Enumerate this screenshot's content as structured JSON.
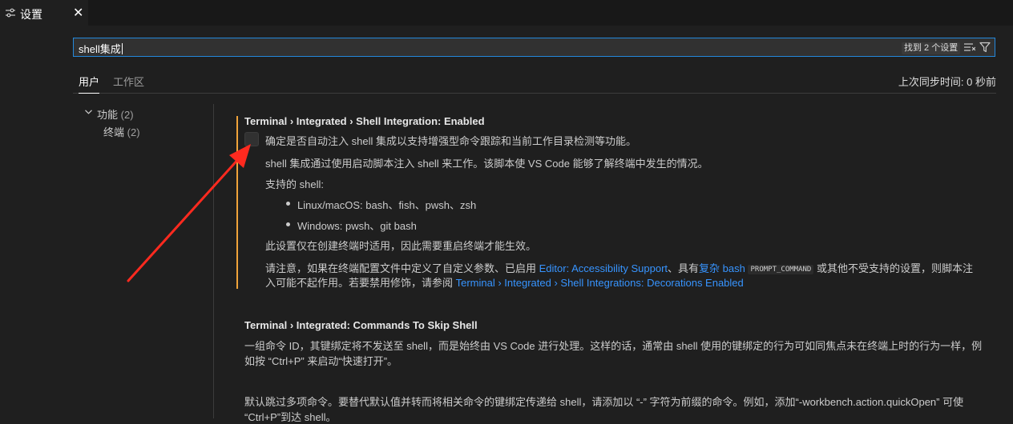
{
  "tab": {
    "title": "设置",
    "close": "✕"
  },
  "search": {
    "value": "shell集成",
    "result_count": "找到 2 个设置"
  },
  "scope_tabs": [
    {
      "label": "用户"
    },
    {
      "label": "工作区"
    }
  ],
  "sync_status": "上次同步时间: 0 秒前",
  "toc": [
    {
      "label": "功能",
      "count": "(2)"
    },
    {
      "label": "终端",
      "count": "(2)"
    }
  ],
  "settings": [
    {
      "title": "Terminal › Integrated › Shell Integration: Enabled",
      "checkbox_label": "确定是否自动注入 shell 集成以支持增强型命令跟踪和当前工作目录检测等功能。",
      "p1": "shell 集成通过使用启动脚本注入 shell 来工作。该脚本使 VS Code 能够了解终端中发生的情况。",
      "supported_label": "支持的 shell:",
      "list": [
        "Linux/macOS: bash、fish、pwsh、zsh",
        "Windows: pwsh、git bash"
      ],
      "p2": "此设置仅在创建终端时适用，因此需要重启终端才能生效。",
      "note": {
        "pre": "请注意，如果在终端配置文件中定义了自定义参数、已启用 ",
        "link1": "Editor: Accessibility Support",
        "mid1": "、具有",
        "link2": "复杂 bash",
        "code": "PROMPT_COMMAND",
        "mid2": " 或其他不受支持的设置，则脚本注",
        "line2_pre": "入可能不起作用。若要禁用修饰，请参阅 ",
        "link3": "Terminal › Integrated › Shell Integrations: Decorations Enabled"
      }
    },
    {
      "title": "Terminal › Integrated: Commands To Skip Shell",
      "desc_line1": "一组命令 ID，其键绑定将不发送至 shell，而是始终由 VS Code 进行处理。这样的话，通常由 shell 使用的键绑定的行为可如同焦点未在终端上时的行为一样，例",
      "desc_line2": "如按 “Ctrl+P” 来启动“快速打开”。",
      "desc2_line1": "默认跳过多项命令。要替代默认值并转而将相关命令的键绑定传递给 shell，请添加以 “-” 字符为前缀的命令。例如，添加“-workbench.action.quickOpen” 可使",
      "desc2_line2": "“Ctrl+P”到达 shell。"
    }
  ],
  "colors": {
    "modified_indicator": "#f0a33a",
    "link": "#3794ff",
    "focus_border": "#2488db",
    "annotation_arrow": "#ff2a1f"
  },
  "icons": [
    "settings-icon",
    "close-icon",
    "clear-filter-icon",
    "filter-icon",
    "chevron-down-icon"
  ]
}
